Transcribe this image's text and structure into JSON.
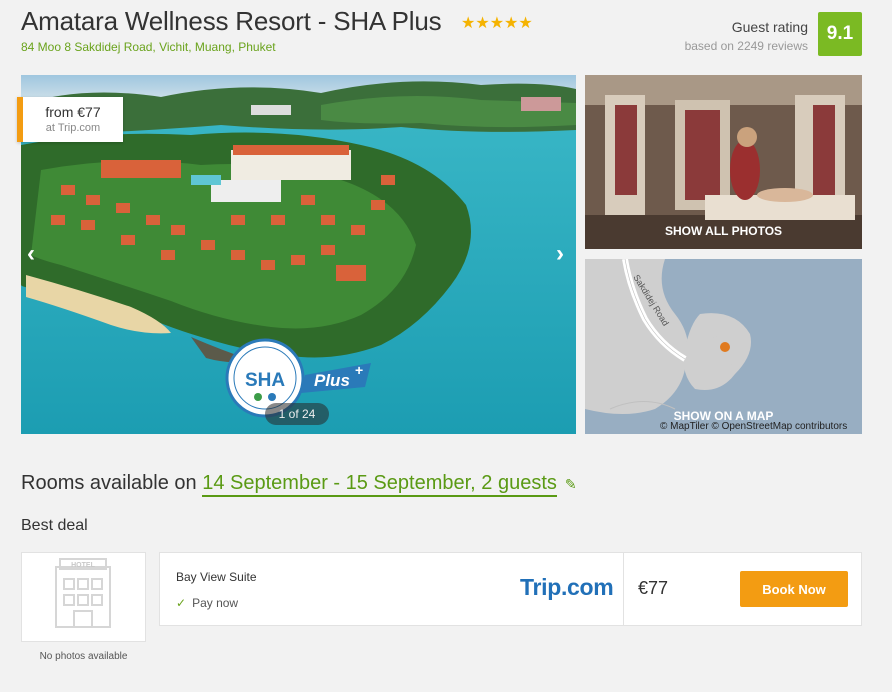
{
  "hotel": {
    "name": "Amatara Wellness Resort - SHA Plus",
    "stars": "★★★★★",
    "address": "84 Moo 8 Sakdidej Road, Vichit, Muang, Phuket"
  },
  "rating": {
    "label": "Guest rating",
    "reviews": "based on 2249 reviews",
    "score": "9.1",
    "badge_color": "#7bba23"
  },
  "gallery": {
    "price_from": "from €77",
    "price_source": "at Trip.com",
    "sha_text": "SHA",
    "sha_plus": "Plus",
    "counter": "1 of 24",
    "prev_icon": "chevron-left-icon",
    "next_icon": "chevron-right-icon",
    "show_all": "SHOW ALL PHOTOS",
    "show_map": "SHOW ON A MAP",
    "map_credit": "© MapTiler © OpenStreetMap contributors",
    "map_road": "Sakdidej Road"
  },
  "rooms": {
    "prefix": "Rooms available on",
    "dates": "14 September - 15 September, 2 guests",
    "edit_icon": "pencil-icon"
  },
  "best_deal": {
    "heading": "Best deal",
    "no_photos": "No photos available",
    "hotel_sign": "HOTEL",
    "room": "Bay View Suite",
    "payment": "Pay now",
    "provider": "Trip.com",
    "price": "€77",
    "button": "Book Now",
    "accent": "#f39c12"
  }
}
